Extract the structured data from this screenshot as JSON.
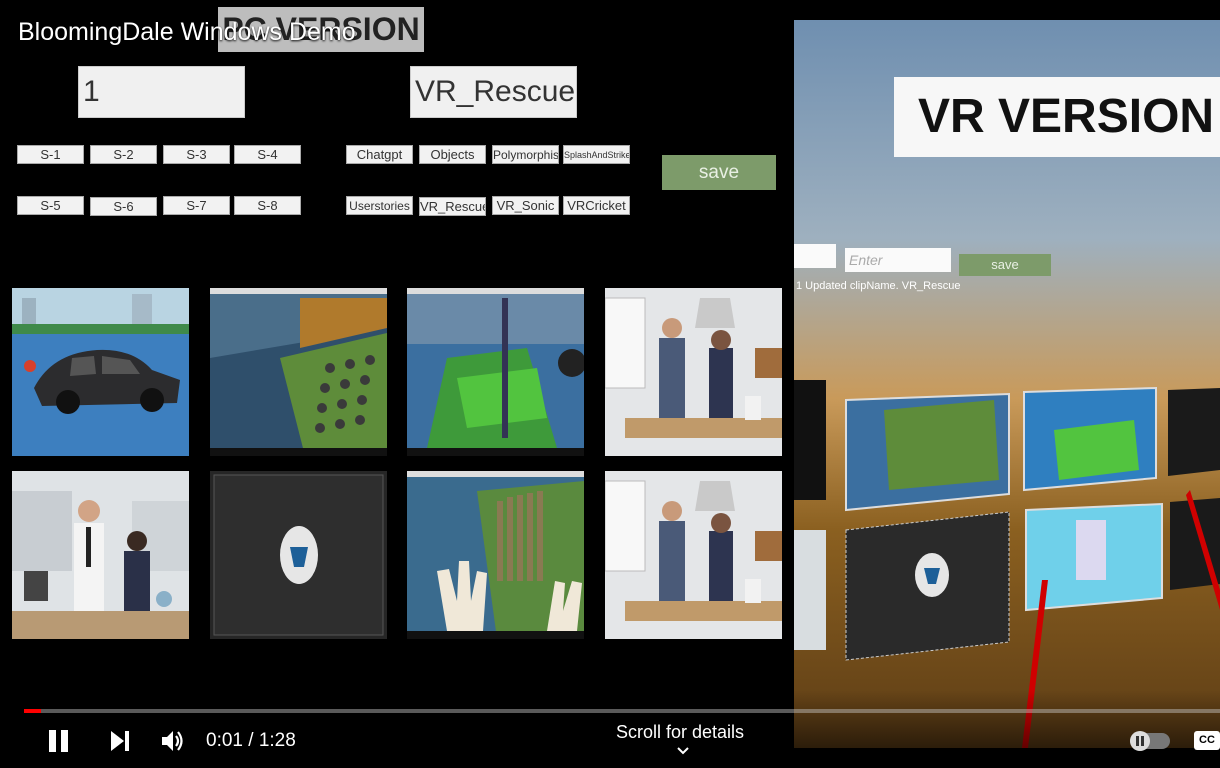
{
  "video": {
    "title": "BloomingDale Windows Demo",
    "time_current": "0:01",
    "time_total": "1:28",
    "progress_fraction": 0.014,
    "scroll_hint": "Scroll for details"
  },
  "pc": {
    "banner": "PC VERSION",
    "field_number": "1",
    "field_name": "VR_Rescue",
    "scene_buttons": [
      "S-1",
      "S-2",
      "S-3",
      "S-4",
      "S-5",
      "S-6",
      "S-7",
      "S-8"
    ],
    "clip_buttons": [
      "Chatgpt",
      "Objects",
      "Polymorphism",
      "SplashAndStrike",
      "Userstories",
      "VR_Rescue",
      "VR_Sonic",
      "VRCricket"
    ],
    "save_label": "save"
  },
  "vr": {
    "banner": "VR VERSION",
    "input_placeholder": "Enter",
    "save_label": "save",
    "status": "1 Updated clipName. VR_Rescue"
  },
  "colors": {
    "progress": "#ff0000",
    "save_green": "#7d9b6a",
    "ray": "#d00000"
  }
}
